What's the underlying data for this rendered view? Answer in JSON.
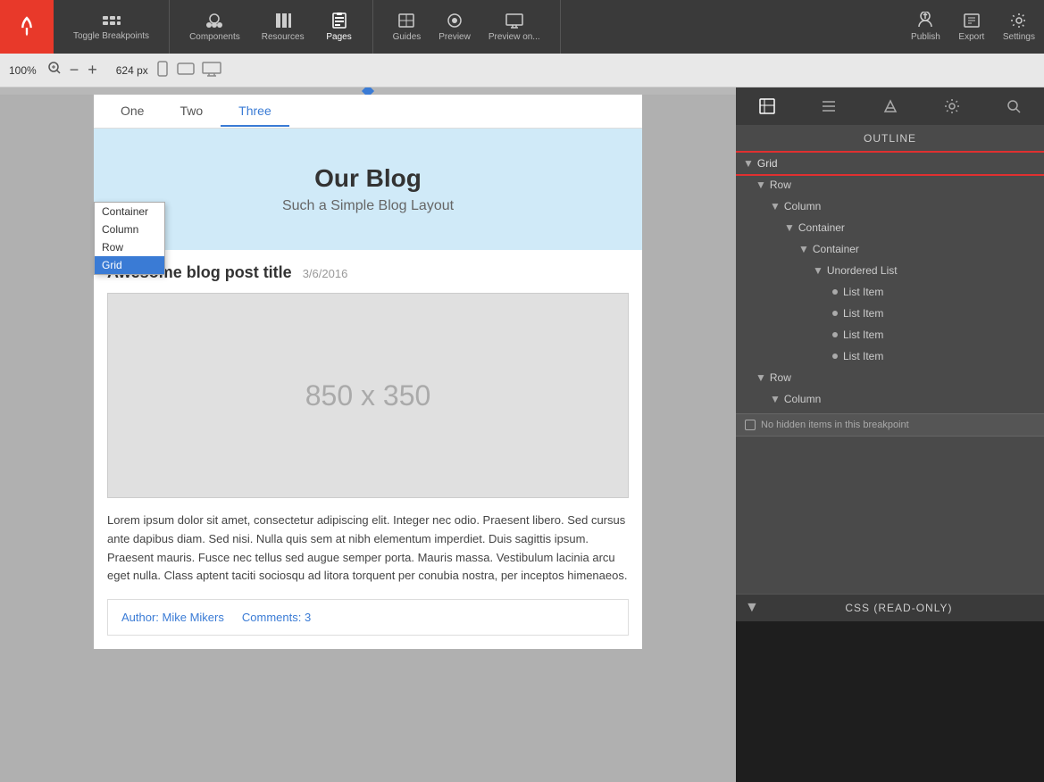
{
  "toolbar": {
    "logo": "rocket-icon",
    "toggle_breakpoints": "Toggle Breakpoints",
    "components": "Components",
    "resources": "Resources",
    "pages": "Pages",
    "guides": "Guides",
    "preview": "Preview",
    "preview_on": "Preview on...",
    "publish": "Publish",
    "export": "Export",
    "settings": "Settings"
  },
  "zoombar": {
    "zoom_pct": "100%",
    "size_px": "624 px"
  },
  "canvas": {
    "tabs": [
      "One",
      "Two",
      "Three"
    ],
    "active_tab": "Three",
    "dropdown": {
      "current": "Grid",
      "options": [
        "Container",
        "Column",
        "Row",
        "Grid"
      ]
    },
    "blog": {
      "header_title": "Our Blog",
      "header_subtitle": "Such a Simple Blog Layout",
      "post_title": "Awesome blog post title",
      "post_date": "3/6/2016",
      "image_placeholder": "850 x 350",
      "body_text": "Lorem ipsum dolor sit amet, consectetur adipiscing elit. Integer nec odio. Praesent libero. Sed cursus ante dapibus diam. Sed nisi. Nulla quis sem at nibh elementum imperdiet. Duis sagittis ipsum. Praesent mauris. Fusce nec tellus sed augue semper porta. Mauris massa. Vestibulum lacinia arcu eget nulla. Class aptent taciti sociosqu ad litora torquent per conubia nostra, per inceptos himenaeos.",
      "author_link": "Author: Mike Mikers",
      "comments_link": "Comments: 3"
    }
  },
  "outline": {
    "header": "OUTLINE",
    "tree": [
      {
        "label": "Grid",
        "level": 0,
        "expanded": true,
        "selected": true
      },
      {
        "label": "Row",
        "level": 1,
        "expanded": true
      },
      {
        "label": "Column",
        "level": 2,
        "expanded": true
      },
      {
        "label": "Container",
        "level": 3,
        "expanded": true
      },
      {
        "label": "Container",
        "level": 4,
        "expanded": true
      },
      {
        "label": "Unordered List",
        "level": 5,
        "expanded": true
      },
      {
        "label": "List Item",
        "level": 6,
        "bullet": true
      },
      {
        "label": "List Item",
        "level": 6,
        "bullet": true
      },
      {
        "label": "List Item",
        "level": 6,
        "bullet": true
      },
      {
        "label": "List Item",
        "level": 6,
        "bullet": true
      },
      {
        "label": "Row",
        "level": 1,
        "expanded": true
      },
      {
        "label": "Column",
        "level": 2,
        "expanded": false
      }
    ],
    "hidden_info": "No hidden items in this breakpoint"
  },
  "css_panel": {
    "header": "CSS (READ-ONLY)"
  },
  "right_tabs": [
    {
      "id": "layout",
      "icon": "layout-icon"
    },
    {
      "id": "styles",
      "icon": "styles-icon"
    },
    {
      "id": "paint",
      "icon": "paint-icon"
    },
    {
      "id": "settings",
      "icon": "settings-icon"
    },
    {
      "id": "search",
      "icon": "search-icon"
    }
  ]
}
